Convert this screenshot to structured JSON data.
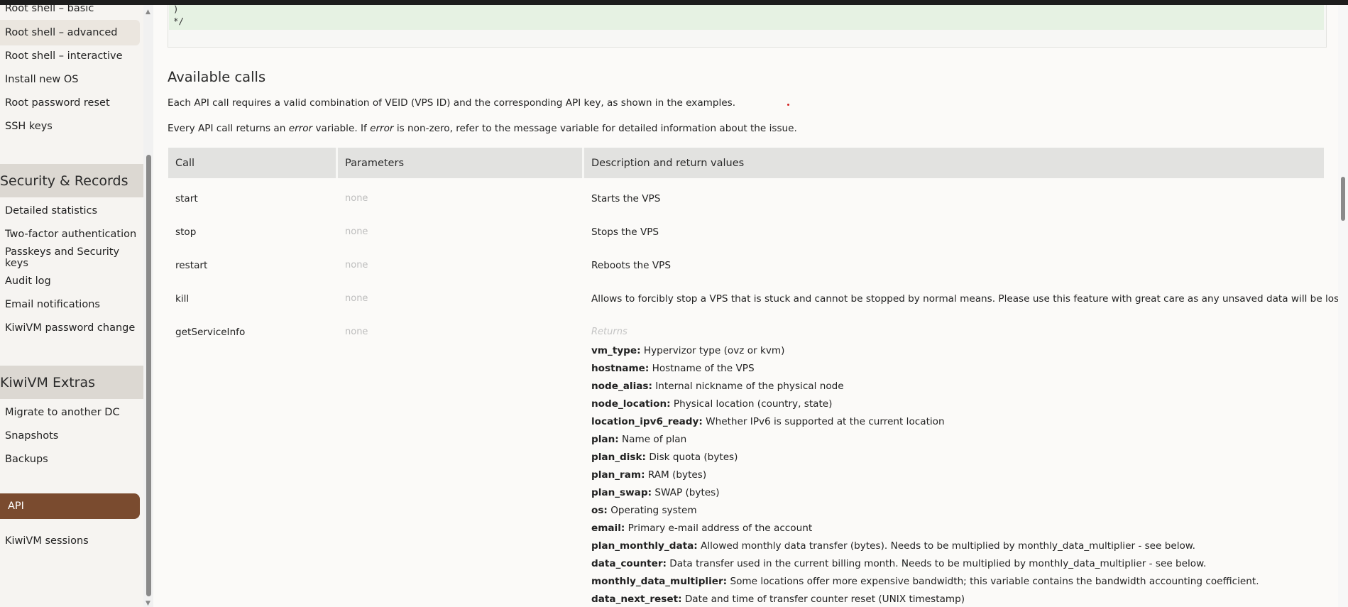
{
  "sidebar": {
    "items_top": [
      {
        "label": "Root shell – basic"
      },
      {
        "label": "Root shell – advanced"
      },
      {
        "label": "Root shell – interactive"
      },
      {
        "label": "Install new OS"
      },
      {
        "label": "Root password reset"
      },
      {
        "label": "SSH keys"
      }
    ],
    "section_security": "Security & Records",
    "items_security": [
      {
        "label": "Detailed statistics"
      },
      {
        "label": "Two-factor authentication"
      },
      {
        "label": "Passkeys and Security keys"
      },
      {
        "label": "Audit log"
      },
      {
        "label": "Email notifications"
      },
      {
        "label": "KiwiVM password change"
      }
    ],
    "section_extras": "KiwiVM Extras",
    "items_extras": [
      {
        "label": "Migrate to another DC"
      },
      {
        "label": "Snapshots"
      },
      {
        "label": "Backups"
      },
      {
        "label": "API"
      },
      {
        "label": "KiwiVM sessions"
      }
    ]
  },
  "code": {
    "line1": ")",
    "line2": "*/"
  },
  "main": {
    "title": "Available calls",
    "para1": "Each API call requires a valid combination of VEID (VPS ID) and the corresponding API key, as shown in the examples.",
    "para2_a": "Every API call returns an ",
    "para2_em1": "error",
    "para2_b": " variable. If ",
    "para2_em2": "error",
    "para2_c": " is non-zero, refer to the message variable for detailed information about the issue."
  },
  "table": {
    "headers": {
      "call": "Call",
      "params": "Parameters",
      "desc": "Description and return values"
    },
    "rows": [
      {
        "call": "start",
        "params": "none",
        "desc": "Starts the VPS"
      },
      {
        "call": "stop",
        "params": "none",
        "desc": "Stops the VPS"
      },
      {
        "call": "restart",
        "params": "none",
        "desc": "Reboots the VPS"
      },
      {
        "call": "kill",
        "params": "none",
        "desc": "Allows to forcibly stop a VPS that is stuck and cannot be stopped by normal means. Please use this feature with great care as any unsaved data will be lost."
      },
      {
        "call": "getServiceInfo",
        "params": "none",
        "desc": "Returns"
      }
    ],
    "returns": [
      {
        "key": "vm_type:",
        "text": " Hypervizor type (ovz or kvm)"
      },
      {
        "key": "hostname:",
        "text": " Hostname of the VPS"
      },
      {
        "key": "node_alias:",
        "text": " Internal nickname of the physical node"
      },
      {
        "key": "node_location:",
        "text": " Physical location (country, state)"
      },
      {
        "key": "location_ipv6_ready:",
        "text": " Whether IPv6 is supported at the current location"
      },
      {
        "key": "plan:",
        "text": " Name of plan"
      },
      {
        "key": "plan_disk:",
        "text": " Disk quota (bytes)"
      },
      {
        "key": "plan_ram:",
        "text": " RAM (bytes)"
      },
      {
        "key": "plan_swap:",
        "text": " SWAP (bytes)"
      },
      {
        "key": "os:",
        "text": " Operating system"
      },
      {
        "key": "email:",
        "text": " Primary e-mail address of the account"
      },
      {
        "key": "plan_monthly_data:",
        "text": " Allowed monthly data transfer (bytes). Needs to be multiplied by monthly_data_multiplier - see below."
      },
      {
        "key": "data_counter:",
        "text": " Data transfer used in the current billing month. Needs to be multiplied by monthly_data_multiplier - see below."
      },
      {
        "key": "monthly_data_multiplier:",
        "text": " Some locations offer more expensive bandwidth; this variable contains the bandwidth accounting coefficient."
      },
      {
        "key": "data_next_reset:",
        "text": " Date and time of transfer counter reset (UNIX timestamp)"
      }
    ]
  },
  "colors": {
    "accent": "#7a4b2f",
    "section_bg": "#dcd8d2",
    "table_header_bg": "#e2e2e0",
    "code_highlight": "#e6f2e3"
  }
}
